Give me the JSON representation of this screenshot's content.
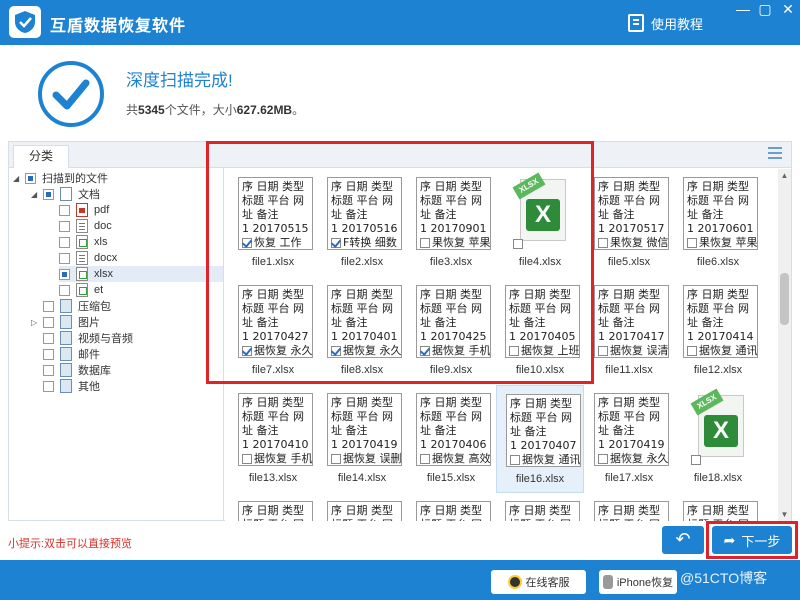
{
  "app": {
    "title": "互盾数据恢复软件",
    "help_label": "使用教程",
    "min_label": "—",
    "max_label": "▢",
    "close_label": "✕"
  },
  "result": {
    "title": "深度扫描完成!",
    "summary_prefix": "共",
    "file_count": "5345",
    "summary_mid": "个文件，大小",
    "total_size": "627.62MB",
    "summary_suffix": "。"
  },
  "tab": {
    "label": "分类"
  },
  "tree": {
    "root": "扫描到的文件",
    "documents": "文档",
    "doc_types": [
      "pdf",
      "doc",
      "xls",
      "docx",
      "xlsx",
      "et"
    ],
    "others": [
      "压缩包",
      "图片",
      "视频与音频",
      "邮件",
      "数据库",
      "其他"
    ]
  },
  "thumb_lines": [
    "序 日期 类型",
    "标题 平台 网",
    "址 备注"
  ],
  "files": [
    {
      "name": "file1.xlsx",
      "line4": "1 20170515",
      "line5": "恢复 工作",
      "checked": true,
      "type": "thumb"
    },
    {
      "name": "file2.xlsx",
      "line4": "1 20170516",
      "line5": "F转换 细数",
      "checked": true,
      "type": "thumb"
    },
    {
      "name": "file3.xlsx",
      "line4": "1 20170901",
      "line5": "果恢复 苹果",
      "checked": false,
      "type": "thumb"
    },
    {
      "name": "file4.xlsx",
      "type": "icon"
    },
    {
      "name": "file5.xlsx",
      "line4": "1 20170517",
      "line5": "果恢复 微信",
      "checked": false,
      "type": "thumb"
    },
    {
      "name": "file6.xlsx",
      "line4": "1 20170601",
      "line5": "果恢复 苹果",
      "checked": false,
      "type": "thumb"
    },
    {
      "name": "file7.xlsx",
      "line4": "1 20170427",
      "line5": "据恢复 永久",
      "checked": true,
      "type": "thumb"
    },
    {
      "name": "file8.xlsx",
      "line4": "1 20170401",
      "line5": "据恢复 永久",
      "checked": true,
      "type": "thumb"
    },
    {
      "name": "file9.xlsx",
      "line4": "1 20170425",
      "line5": "据恢复 手机",
      "checked": true,
      "type": "thumb"
    },
    {
      "name": "file10.xlsx",
      "line4": "1 20170405",
      "line5": "据恢复 上班",
      "checked": false,
      "type": "thumb"
    },
    {
      "name": "file11.xlsx",
      "line4": "1 20170417",
      "line5": "据恢复 误清",
      "checked": false,
      "type": "thumb"
    },
    {
      "name": "file12.xlsx",
      "line4": "1 20170414",
      "line5": "据恢复 通讯",
      "checked": false,
      "type": "thumb"
    },
    {
      "name": "file13.xlsx",
      "line4": "1 20170410",
      "line5": "据恢复 手机",
      "checked": false,
      "type": "thumb"
    },
    {
      "name": "file14.xlsx",
      "line4": "1 20170419",
      "line5": "据恢复 误删",
      "checked": false,
      "type": "thumb"
    },
    {
      "name": "file15.xlsx",
      "line4": "1 20170406",
      "line5": "据恢复 高效",
      "checked": false,
      "type": "thumb"
    },
    {
      "name": "file16.xlsx",
      "line4": "1 20170407",
      "line5": "据恢复 通讯",
      "checked": false,
      "type": "thumb",
      "selected": true
    },
    {
      "name": "file17.xlsx",
      "line4": "1 20170419",
      "line5": "据恢复 永久",
      "checked": false,
      "type": "thumb"
    },
    {
      "name": "file18.xlsx",
      "type": "icon"
    },
    {
      "name": "",
      "line4": "",
      "line5": "",
      "checked": false,
      "type": "thumb"
    },
    {
      "name": "",
      "line4": "",
      "line5": "",
      "checked": false,
      "type": "thumb"
    },
    {
      "name": "",
      "line4": "",
      "line5": "",
      "checked": false,
      "type": "thumb"
    },
    {
      "name": "",
      "line4": "",
      "line5": "",
      "checked": false,
      "type": "thumb"
    },
    {
      "name": "",
      "line4": "",
      "line5": "",
      "checked": false,
      "type": "thumb"
    },
    {
      "name": "",
      "line4": "",
      "line5": "",
      "checked": false,
      "type": "thumb"
    }
  ],
  "icons": {
    "logo": "shield-check-icon",
    "help": "book-icon",
    "back": "undo-arrow-icon",
    "next": "share-arrow-icon",
    "online": "qq-penguin-icon",
    "iphone": "apple-icon",
    "excel": "excel-file-icon"
  },
  "colors": {
    "brand": "#1e82d2",
    "highlight": "#e0222a",
    "tip": "#d9302b",
    "excel": "#2e8b3a"
  },
  "bottom": {
    "tip": "小提示:双击可以直接预览",
    "back_label": "↶",
    "next_label": "下一步",
    "online_label": "在线客服",
    "iphone_label": "iPhone恢复",
    "watermark": "@51CTO博客"
  }
}
